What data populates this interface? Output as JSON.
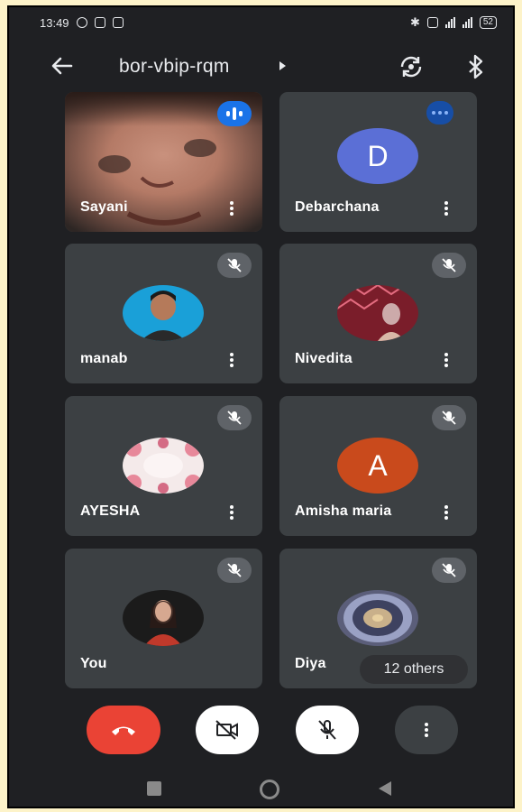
{
  "status_bar": {
    "time": "13:49",
    "battery": "52"
  },
  "header": {
    "meeting_code": "bor-vbip-rqm"
  },
  "participants": [
    {
      "name": "Sayani",
      "type": "video",
      "state": "speaking"
    },
    {
      "name": "Debarchana",
      "type": "letter",
      "initial": "D",
      "avatar_color": "#5b6fd6",
      "state": "more"
    },
    {
      "name": "manab",
      "type": "photo",
      "state": "muted"
    },
    {
      "name": "Nivedita",
      "type": "photo",
      "state": "muted"
    },
    {
      "name": "AYESHA",
      "type": "photo",
      "state": "muted"
    },
    {
      "name": "Amisha maria",
      "type": "letter",
      "initial": "A",
      "avatar_color": "#c94a1c",
      "state": "muted"
    },
    {
      "name": "You",
      "type": "photo",
      "state": "muted"
    },
    {
      "name": "Diya",
      "type": "photo",
      "state": "muted"
    }
  ],
  "others_label": "12 others",
  "colors": {
    "background": "#1f2023",
    "tile": "#3c4043",
    "end_call": "#ea4335",
    "speaking": "#1a73e8"
  },
  "icons": [
    "back-arrow-icon",
    "switch-camera-icon",
    "bluetooth-icon",
    "microphone-off-icon",
    "end-call-icon",
    "camera-off-icon",
    "more-vert-icon"
  ]
}
